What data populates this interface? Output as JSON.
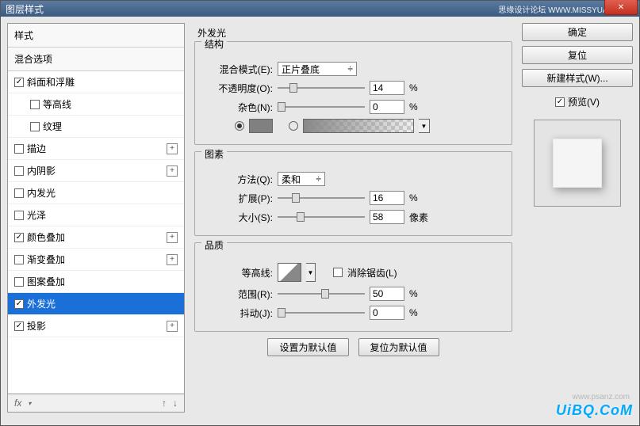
{
  "titlebar": {
    "title": "图层样式",
    "right": "思缘设计论坛  WWW.MISSYUAN.COM"
  },
  "left": {
    "header_styles": "样式",
    "header_blend": "混合选项",
    "items": [
      {
        "label": "斜面和浮雕",
        "checked": true,
        "add": false,
        "indent": false
      },
      {
        "label": "等高线",
        "checked": false,
        "add": false,
        "indent": true
      },
      {
        "label": "纹理",
        "checked": false,
        "add": false,
        "indent": true
      },
      {
        "label": "描边",
        "checked": false,
        "add": true,
        "indent": false
      },
      {
        "label": "内阴影",
        "checked": false,
        "add": true,
        "indent": false
      },
      {
        "label": "内发光",
        "checked": false,
        "add": false,
        "indent": false
      },
      {
        "label": "光泽",
        "checked": false,
        "add": false,
        "indent": false
      },
      {
        "label": "颜色叠加",
        "checked": true,
        "add": true,
        "indent": false
      },
      {
        "label": "渐变叠加",
        "checked": false,
        "add": true,
        "indent": false
      },
      {
        "label": "图案叠加",
        "checked": false,
        "add": false,
        "indent": false
      },
      {
        "label": "外发光",
        "checked": true,
        "add": false,
        "indent": false,
        "selected": true
      },
      {
        "label": "投影",
        "checked": true,
        "add": true,
        "indent": false
      }
    ],
    "footer_fx": "fx"
  },
  "middle": {
    "panel_title": "外发光",
    "structure": {
      "title": "结构",
      "blend_label": "混合模式(E):",
      "blend_value": "正片叠底",
      "opacity_label": "不透明度(O):",
      "opacity_value": "14",
      "opacity_unit": "%",
      "noise_label": "杂色(N):",
      "noise_value": "0",
      "noise_unit": "%"
    },
    "elements": {
      "title": "图素",
      "technique_label": "方法(Q):",
      "technique_value": "柔和",
      "spread_label": "扩展(P):",
      "spread_value": "16",
      "spread_unit": "%",
      "size_label": "大小(S):",
      "size_value": "58",
      "size_unit": "像素"
    },
    "quality": {
      "title": "品质",
      "contour_label": "等高线:",
      "antialias_label": "消除锯齿(L)",
      "range_label": "范围(R):",
      "range_value": "50",
      "range_unit": "%",
      "jitter_label": "抖动(J):",
      "jitter_value": "0",
      "jitter_unit": "%"
    },
    "buttons": {
      "default": "设置为默认值",
      "reset": "复位为默认值"
    }
  },
  "right": {
    "ok": "确定",
    "cancel": "复位",
    "newstyle": "新建样式(W)...",
    "preview_label": "预览(V)"
  },
  "watermark": "UiBQ.CoM",
  "watermark2": "www.psanz.com"
}
